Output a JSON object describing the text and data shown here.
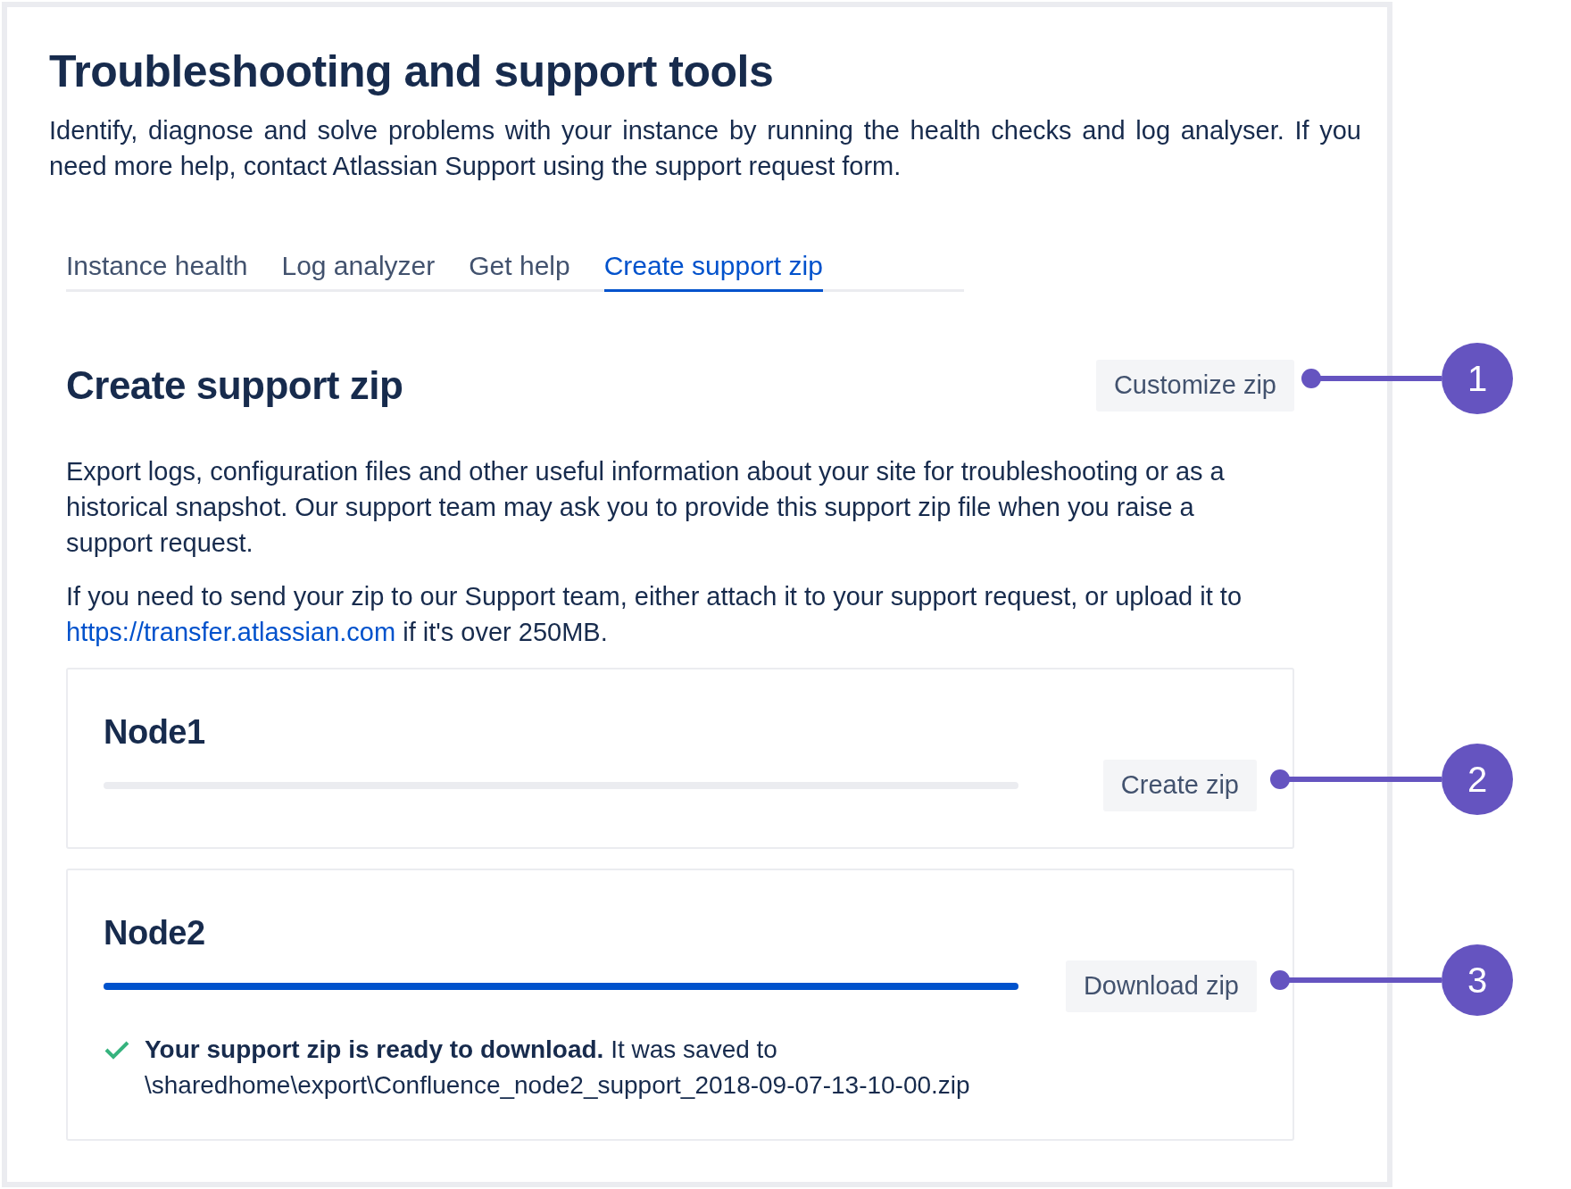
{
  "title": "Troubleshooting and support tools",
  "description": "Identify, diagnose and solve problems with your instance by running the health checks and log analyser. If you need more help, contact Atlassian Support using the support request form.",
  "tabs": [
    {
      "label": "Instance health",
      "selected": false
    },
    {
      "label": "Log analyzer",
      "selected": false
    },
    {
      "label": "Get help",
      "selected": false
    },
    {
      "label": "Create support zip",
      "selected": true
    }
  ],
  "section": {
    "heading": "Create support zip",
    "button": "Customize zip",
    "paragraph_1": "Export logs, configuration files and other useful information about your site for troubleshooting or as a historical snapshot. Our support team may ask you to provide this support zip file when you raise a support request.",
    "paragraph_2": "If you need to send your zip to our Support team, either attach it to your support request, or upload it to",
    "link": "https://transfer.atlassian.com",
    "paragraph_2_end": "if it's over 250MB."
  },
  "nodes": [
    {
      "name": "Node1",
      "level": 0,
      "button": "Create zip"
    },
    {
      "name": "Node2",
      "level": 1,
      "button": "Download zip",
      "message": "**Your support zip is ready to download.** It was saved to \\sharedhome\\export\\Confluence_node2_support_2018-09-07-13-10-00.zip"
    }
  ],
  "callouts": [
    {
      "number": "1"
    },
    {
      "number": "2"
    },
    {
      "number": "3"
    }
  ]
}
